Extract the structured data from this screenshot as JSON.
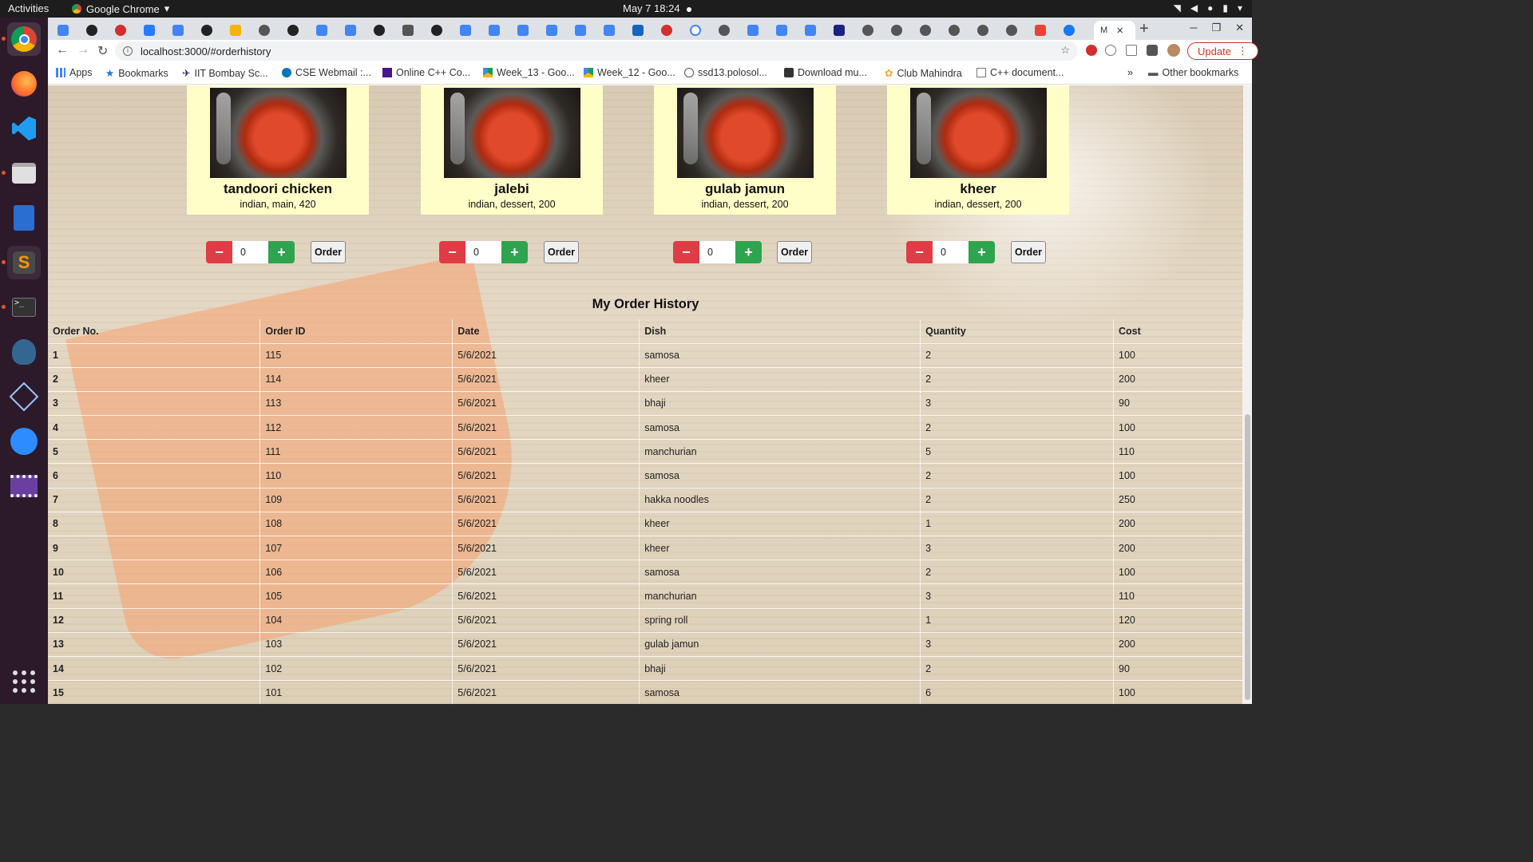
{
  "os": {
    "activities": "Activities",
    "app_name": "Google Chrome",
    "clock": "May 7  18:24"
  },
  "browser": {
    "url": "localhost:3000/#orderhistory",
    "update_label": "Update",
    "bookmarks": [
      "Apps",
      "Bookmarks",
      "IIT Bombay Sc...",
      "CSE Webmail :...",
      "Online C++ Co...",
      "Week_13 - Goo...",
      "Week_12 - Goo...",
      "ssd13.polosol...",
      "Download mu...",
      "Club Mahindra",
      "C++ document..."
    ],
    "other_bookmarks": "Other bookmarks",
    "active_tab_label": "M"
  },
  "dishes": [
    {
      "name": "tandoori chicken",
      "desc": "indian, main, 420",
      "qty": "0"
    },
    {
      "name": "jalebi",
      "desc": "indian, dessert, 200",
      "qty": "0"
    },
    {
      "name": "gulab jamun",
      "desc": "indian, dessert, 200",
      "qty": "0"
    },
    {
      "name": "kheer",
      "desc": "indian, dessert, 200",
      "qty": "0"
    }
  ],
  "order_button_label": "Order",
  "history": {
    "title": "My Order History",
    "columns": [
      "Order No.",
      "Order ID",
      "Date",
      "Dish",
      "Quantity",
      "Cost"
    ],
    "rows": [
      [
        "1",
        "115",
        "5/6/2021",
        "samosa",
        "2",
        "100"
      ],
      [
        "2",
        "114",
        "5/6/2021",
        "kheer",
        "2",
        "200"
      ],
      [
        "3",
        "113",
        "5/6/2021",
        "bhaji",
        "3",
        "90"
      ],
      [
        "4",
        "112",
        "5/6/2021",
        "samosa",
        "2",
        "100"
      ],
      [
        "5",
        "111",
        "5/6/2021",
        "manchurian",
        "5",
        "110"
      ],
      [
        "6",
        "110",
        "5/6/2021",
        "samosa",
        "2",
        "100"
      ],
      [
        "7",
        "109",
        "5/6/2021",
        "hakka noodles",
        "2",
        "250"
      ],
      [
        "8",
        "108",
        "5/6/2021",
        "kheer",
        "1",
        "200"
      ],
      [
        "9",
        "107",
        "5/6/2021",
        "kheer",
        "3",
        "200"
      ],
      [
        "10",
        "106",
        "5/6/2021",
        "samosa",
        "2",
        "100"
      ],
      [
        "11",
        "105",
        "5/6/2021",
        "manchurian",
        "3",
        "110"
      ],
      [
        "12",
        "104",
        "5/6/2021",
        "spring roll",
        "1",
        "120"
      ],
      [
        "13",
        "103",
        "5/6/2021",
        "gulab jamun",
        "3",
        "200"
      ],
      [
        "14",
        "102",
        "5/6/2021",
        "bhaji",
        "2",
        "90"
      ],
      [
        "15",
        "101",
        "5/6/2021",
        "samosa",
        "6",
        "100"
      ]
    ]
  },
  "colors": {
    "card_bg": "#fffdc8",
    "minus_red": "#e03c46",
    "plus_green": "#2ea44f",
    "update_red": "#d93025"
  }
}
